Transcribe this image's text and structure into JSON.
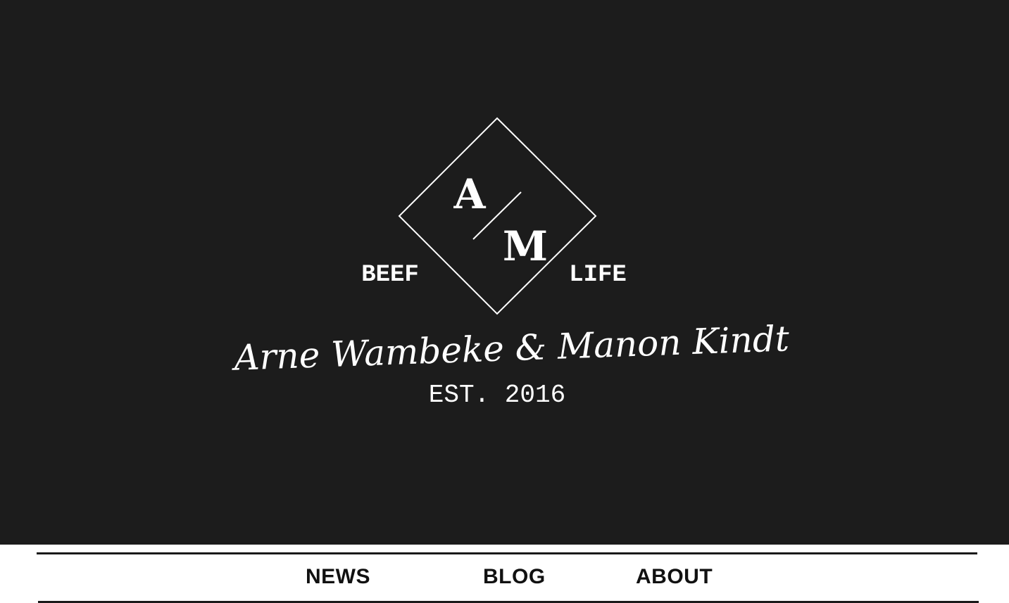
{
  "colors": {
    "hero_background": "#1c1c1c",
    "logo_foreground": "#ffffff",
    "nav_background": "#ffffff",
    "nav_text": "#111111"
  },
  "logo": {
    "initial_top": "A",
    "initial_bottom": "M",
    "left_word": "BEEF",
    "right_word": "LIFE",
    "signature": "Arne Wambeke & Manon Kindt",
    "established": "EST. 2016"
  },
  "nav": {
    "items": [
      {
        "label": "NEWS"
      },
      {
        "label": "BLOG"
      },
      {
        "label": "ABOUT"
      }
    ]
  }
}
